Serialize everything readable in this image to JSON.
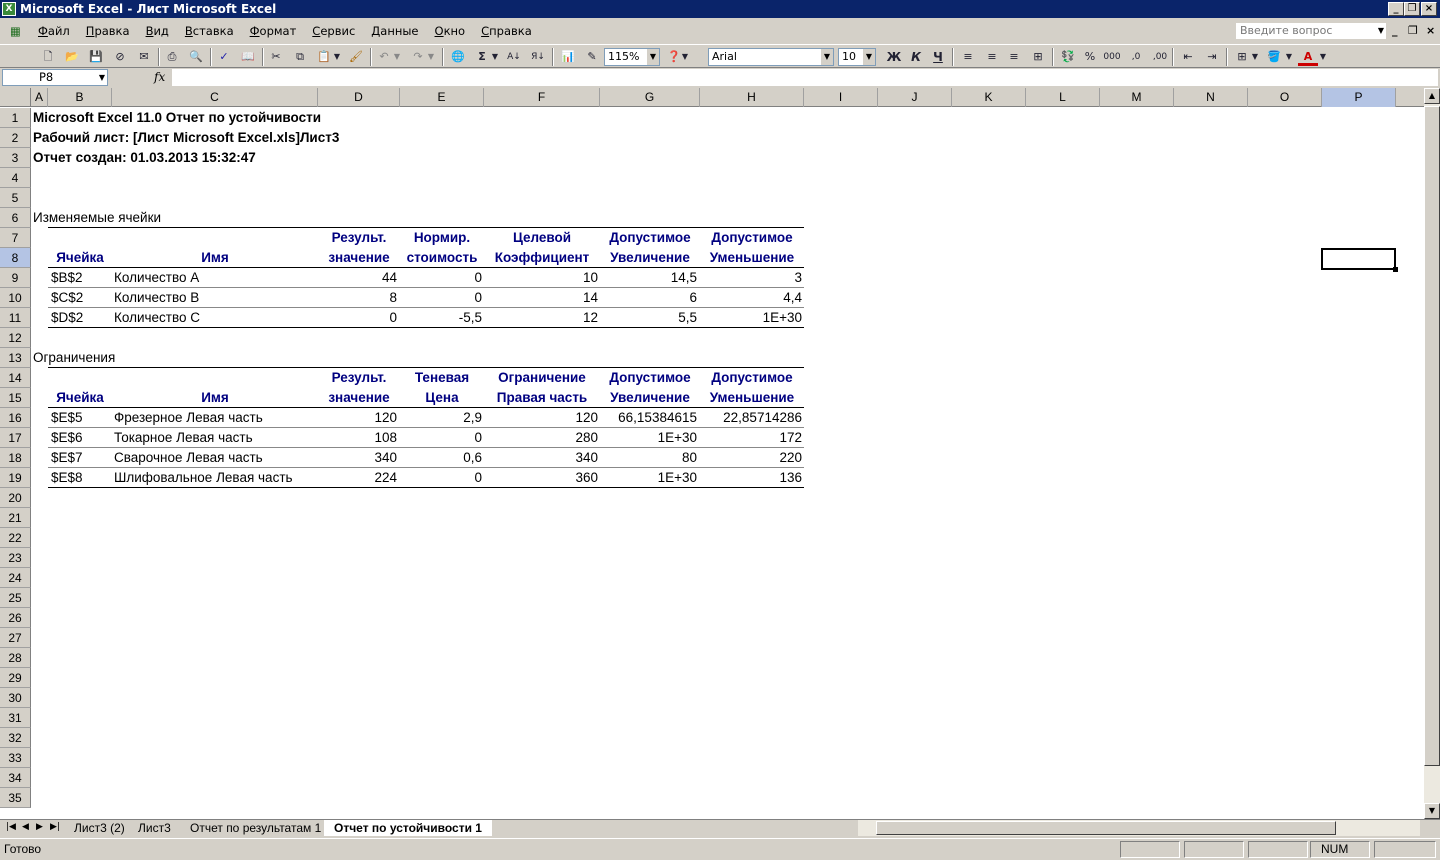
{
  "window": {
    "title": "Microsoft Excel - Лист Microsoft Excel"
  },
  "menu": [
    "Файл",
    "Правка",
    "Вид",
    "Вставка",
    "Формат",
    "Сервис",
    "Данные",
    "Окно",
    "Справка"
  ],
  "help_box": {
    "placeholder": "Введите вопрос"
  },
  "toolbar": {
    "zoom": "115%",
    "font": "Arial",
    "font_size": "10",
    "bold": "Ж",
    "italic": "К",
    "underline": "Ч",
    "sum": "Σ",
    "percent": "%",
    "thousands": "000",
    "font_color_glyph": "A"
  },
  "formula_bar": {
    "name_box": "P8",
    "fx": "fx",
    "value": ""
  },
  "columns": [
    "A",
    "B",
    "C",
    "D",
    "E",
    "F",
    "G",
    "H",
    "I",
    "J",
    "K",
    "L",
    "M",
    "N",
    "O",
    "P"
  ],
  "rows": [
    "1",
    "2",
    "3",
    "4",
    "5",
    "6",
    "7",
    "8",
    "9",
    "10",
    "11",
    "12",
    "13",
    "14",
    "15",
    "16",
    "17",
    "18",
    "19",
    "20",
    "21",
    "22",
    "23",
    "24",
    "25",
    "26",
    "27",
    "28",
    "29",
    "30",
    "31",
    "32",
    "33",
    "34",
    "35"
  ],
  "report": {
    "title": "Microsoft Excel 11.0 Отчет по устойчивости",
    "worksheet": "Рабочий лист: [Лист Microsoft Excel.xls]Лист3",
    "created": "Отчет создан: 01.03.2013 15:32:47",
    "changing": {
      "caption": "Изменяемые ячейки",
      "hdr1": [
        "",
        "",
        "Результ.",
        "Нормир.",
        "Целевой",
        "Допустимое",
        "Допустимое"
      ],
      "hdr2": [
        "Ячейка",
        "Имя",
        "значение",
        "стоимость",
        "Коэффициент",
        "Увеличение",
        "Уменьшение"
      ],
      "rows": [
        [
          "$B$2",
          "Количество A",
          "44",
          "0",
          "10",
          "14,5",
          "3"
        ],
        [
          "$C$2",
          "Количество B",
          "8",
          "0",
          "14",
          "6",
          "4,4"
        ],
        [
          "$D$2",
          "Количество C",
          "0",
          "-5,5",
          "12",
          "5,5",
          "1E+30"
        ]
      ]
    },
    "constraints": {
      "caption": "Ограничения",
      "hdr1": [
        "",
        "",
        "Результ.",
        "Теневая",
        "Ограничение",
        "Допустимое",
        "Допустимое"
      ],
      "hdr2": [
        "Ячейка",
        "Имя",
        "значение",
        "Цена",
        "Правая часть",
        "Увеличение",
        "Уменьшение"
      ],
      "rows": [
        [
          "$E$5",
          "Фрезерное Левая часть",
          "120",
          "2,9",
          "120",
          "66,15384615",
          "22,85714286"
        ],
        [
          "$E$6",
          "Токарное Левая часть",
          "108",
          "0",
          "280",
          "1E+30",
          "172"
        ],
        [
          "$E$7",
          "Сварочное Левая часть",
          "340",
          "0,6",
          "340",
          "80",
          "220"
        ],
        [
          "$E$8",
          "Шлифовальное Левая часть",
          "224",
          "0",
          "360",
          "1E+30",
          "136"
        ]
      ]
    }
  },
  "sheets": [
    "Лист3 (2)",
    "Лист3",
    "Отчет по результатам 1",
    "Отчет по устойчивости 1"
  ],
  "status": {
    "left": "Готово",
    "num": "NUM"
  }
}
